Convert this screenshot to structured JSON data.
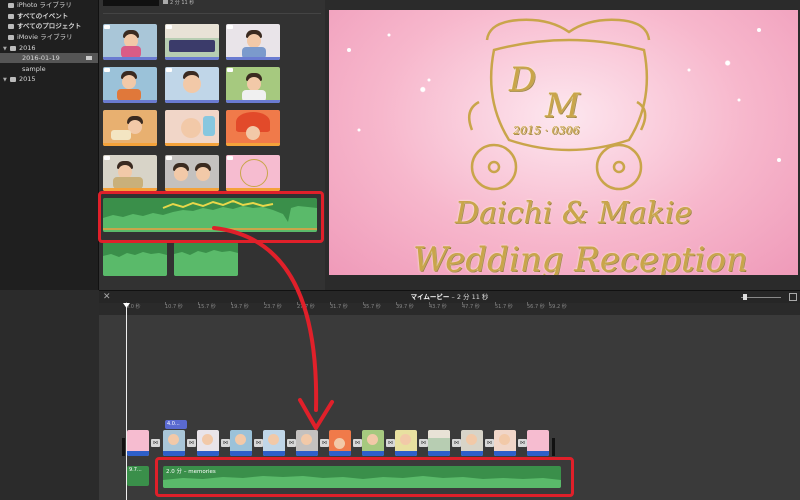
{
  "sidebar": {
    "items": [
      {
        "label": "iPhoto ライブラリ",
        "bold": false
      },
      {
        "label": "すべてのイベント",
        "bold": true
      },
      {
        "label": "すべてのプロジェクト",
        "bold": true
      },
      {
        "label": "iMovie ライブラリ",
        "bold": false
      },
      {
        "label": "2016",
        "bold": false
      },
      {
        "label": "2016-01-19",
        "bold": false
      },
      {
        "label": "sample",
        "bold": false
      },
      {
        "label": "2015",
        "bold": false
      }
    ]
  },
  "browser": {
    "duration_label": "2 分 11 秒"
  },
  "viewer": {
    "monogram_top": "D",
    "monogram_bottom": "M",
    "date_text": "2015 · 0306",
    "names": "Daichi & Makie",
    "subtitle": "Wedding Reception"
  },
  "timeline": {
    "project_title": "マイムービー",
    "duration": "2 分 11 秒",
    "ticks": [
      "0.0 秒",
      "10.7 秒",
      "15.7 秒",
      "19.7 秒",
      "23.7 秒",
      "27.7 秒",
      "31.7 秒",
      "35.7 秒",
      "39.7 秒",
      "43.7 秒",
      "47.7 秒",
      "51.7 秒",
      "56.7 秒",
      "59.2 秒"
    ],
    "first_clip_label": "4.0...",
    "short_audio_label": "9.7...",
    "audio_track_label": "2.0 分 – memories"
  },
  "colors": {
    "highlight_red": "#e0202a",
    "audio_green": "#3a8f4a",
    "clip_blue": "#2e5fc9",
    "accent_orange": "#f4a23a"
  },
  "icons": [
    "close-icon",
    "film-icon",
    "folder-icon",
    "star-icon",
    "camera-icon",
    "transition-icon",
    "zoom-slider",
    "list-view-icon"
  ]
}
